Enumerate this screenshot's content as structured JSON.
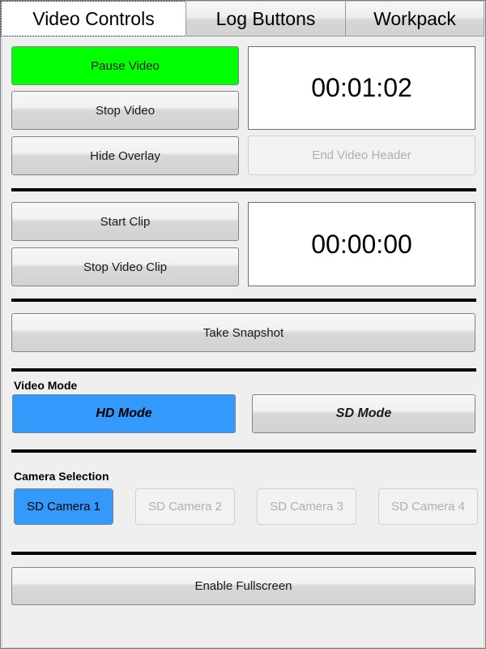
{
  "window": {
    "title": "Video Controls"
  },
  "tabs": [
    {
      "label": "Video Controls",
      "active": true
    },
    {
      "label": "Log Buttons",
      "active": false
    },
    {
      "label": "Workpack",
      "active": false
    }
  ],
  "video_section": {
    "pause_button": "Pause Video",
    "stop_button": "Stop Video",
    "hide_overlay_button": "Hide Overlay",
    "timer": "00:01:02",
    "end_video_header_button": "End Video Header"
  },
  "clip_section": {
    "start_clip_button": "Start Clip",
    "stop_clip_button": "Stop Video Clip",
    "timer": "00:00:00"
  },
  "snapshot_section": {
    "take_snapshot_button": "Take Snapshot"
  },
  "video_mode": {
    "label": "Video Mode",
    "options": [
      {
        "label": "HD Mode",
        "selected": true
      },
      {
        "label": "SD Mode",
        "selected": false
      }
    ]
  },
  "camera_selection": {
    "label": "Camera Selection",
    "options": [
      {
        "label": "SD Camera 1",
        "selected": true,
        "enabled": true
      },
      {
        "label": "SD Camera 2",
        "selected": false,
        "enabled": false
      },
      {
        "label": "SD Camera 3",
        "selected": false,
        "enabled": false
      },
      {
        "label": "SD Camera 4",
        "selected": false,
        "enabled": false
      }
    ]
  },
  "fullscreen_section": {
    "fullscreen_button": "Enable Fullscreen"
  },
  "colors": {
    "active_green": "#00ff00",
    "selected_blue": "#3399fa",
    "panel_background": "#efefef",
    "separator": "#000000",
    "disabled_text": "#b0b0b0"
  }
}
